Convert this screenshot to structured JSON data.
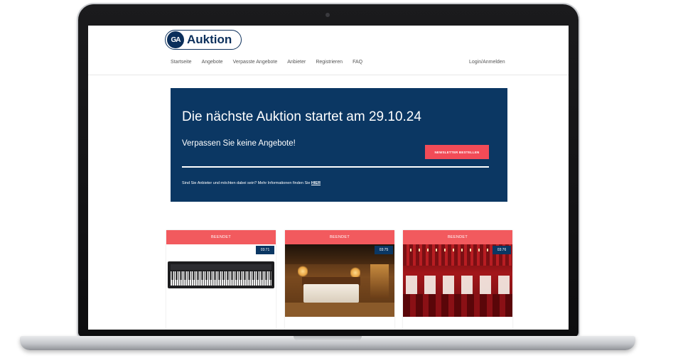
{
  "site": {
    "logo_mark": "GA",
    "logo_text": "Auktion"
  },
  "nav": {
    "items": [
      "Startseite",
      "Angebote",
      "Verpasste Angebote",
      "Anbieter",
      "Registrieren",
      "FAQ"
    ],
    "login": "Login/Anmelden"
  },
  "hero": {
    "title": "Die nächste Auktion startet am 29.10.24",
    "subtitle": "Verpassen Sie keine Angebote!",
    "button_label": "NEWSLETTER BESTELLEN",
    "info_text": "Sind Sie Anbieter und möchten dabei sein? Mehr Informationen finden Sie ",
    "info_link": "HIER"
  },
  "cards": [
    {
      "status": "BEENDET",
      "time": "03:71",
      "image": "keyboard-piano"
    },
    {
      "status": "BEENDET",
      "time": "03:75",
      "image": "hotel-room"
    },
    {
      "status": "BEENDET",
      "time": "03:76",
      "image": "restaurant-hall"
    }
  ],
  "colors": {
    "navy": "#0b3763",
    "accent_red": "#f24b57",
    "status_red": "#f25a5e"
  }
}
